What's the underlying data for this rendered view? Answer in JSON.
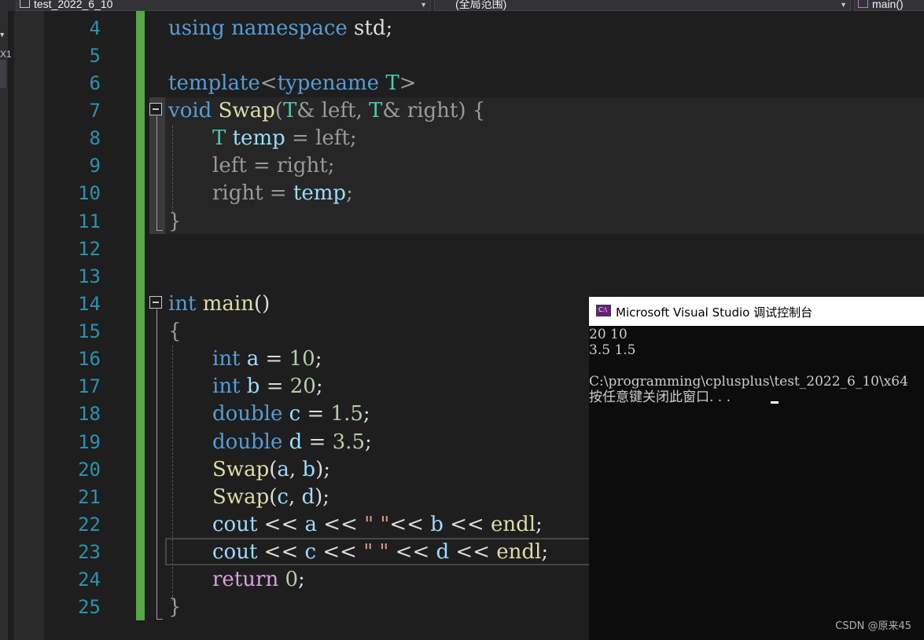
{
  "nav": {
    "project": "test_2022_6_10",
    "scope": "(全局范围)",
    "member": "main()"
  },
  "left_strip": {
    "mark1": "▼",
    "mark2": "X1"
  },
  "editor": {
    "line_numbers": [
      "4",
      "5",
      "6",
      "7",
      "8",
      "9",
      "10",
      "11",
      "12",
      "13",
      "14",
      "15",
      "16",
      "17",
      "18",
      "19",
      "20",
      "21",
      "22",
      "23",
      "24",
      "25"
    ],
    "code": {
      "l4": [
        "using",
        " ",
        "namespace",
        " std;"
      ],
      "l6": [
        "template",
        "<",
        "typename",
        " ",
        "T",
        ">"
      ],
      "l7": [
        "void",
        " ",
        "Swap",
        "(",
        "T",
        "& ",
        "left",
        ", ",
        "T",
        "& ",
        "right",
        ") {"
      ],
      "l8": [
        "T",
        " ",
        "temp",
        " = ",
        "left",
        ";"
      ],
      "l9": [
        "left",
        " = ",
        "right",
        ";"
      ],
      "l10": [
        "right",
        " = ",
        "temp",
        ";"
      ],
      "l11": [
        "}"
      ],
      "l14": [
        "int",
        " ",
        "main",
        "()"
      ],
      "l15": [
        "{"
      ],
      "l16": [
        "int",
        " ",
        "a",
        " = ",
        "10",
        ";"
      ],
      "l17": [
        "int",
        " ",
        "b",
        " = ",
        "20",
        ";"
      ],
      "l18": [
        "double",
        " ",
        "c",
        " = ",
        "1.5",
        ";"
      ],
      "l19": [
        "double",
        " ",
        "d",
        " = ",
        "3.5",
        ";"
      ],
      "l20": [
        "Swap",
        "(",
        "a",
        ", ",
        "b",
        ");"
      ],
      "l21": [
        "Swap",
        "(",
        "c",
        ", ",
        "d",
        ");"
      ],
      "l22": [
        "cout",
        " << ",
        "a",
        " << ",
        "\" \"",
        "<< ",
        "b",
        " << ",
        "endl",
        ";"
      ],
      "l23": [
        "cout",
        " << ",
        "c",
        " << ",
        "\" \"",
        " << ",
        "d",
        " << ",
        "endl",
        ";"
      ],
      "l24": [
        "return",
        " ",
        "0",
        ";"
      ],
      "l25": [
        "}"
      ]
    }
  },
  "console": {
    "title": "Microsoft Visual Studio 调试控制台",
    "icon_label": "C:\\",
    "lines": [
      "20 10",
      "3.5 1.5",
      "",
      "C:\\programming\\cplusplus\\test_2022_6_10\\x64",
      "按任意键关闭此窗口. . ."
    ]
  },
  "watermark": "CSDN @原来45",
  "colors": {
    "keyword": "#569cd6",
    "type": "#4ec9b0",
    "function": "#dcdcaa",
    "variable": "#9cdcfe",
    "number": "#b5cea8",
    "string": "#d69d85",
    "control": "#d8a0df",
    "line_number": "#2b91af",
    "change_bar": "#57a64a"
  }
}
